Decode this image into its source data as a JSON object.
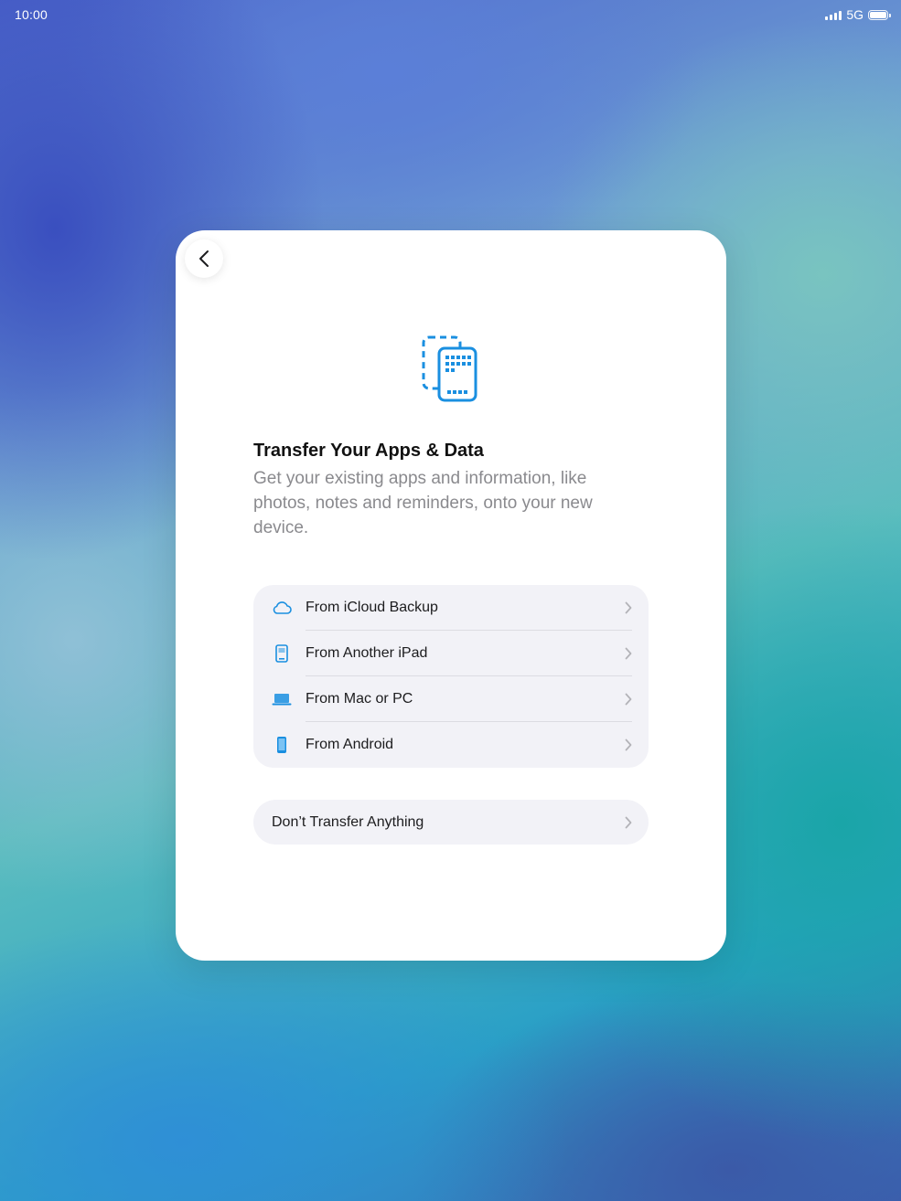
{
  "status_bar": {
    "time": "10:00",
    "network": "5G"
  },
  "colors": {
    "accent": "#1a8fe0",
    "chevron": "#b3b3b8"
  },
  "card": {
    "back_icon": "chevron-left-icon",
    "hero_icon": "transfer-devices-icon",
    "title": "Transfer Your Apps & Data",
    "subtitle": "Get your existing apps and information, like photos, notes and reminders, onto your new device.",
    "options": [
      {
        "label": "From iCloud Backup",
        "icon": "cloud-icon"
      },
      {
        "label": "From Another iPad",
        "icon": "ipad-icon"
      },
      {
        "label": "From Mac or PC",
        "icon": "laptop-icon"
      },
      {
        "label": "From Android",
        "icon": "phone-icon"
      }
    ],
    "skip_label": "Don’t Transfer Anything"
  }
}
